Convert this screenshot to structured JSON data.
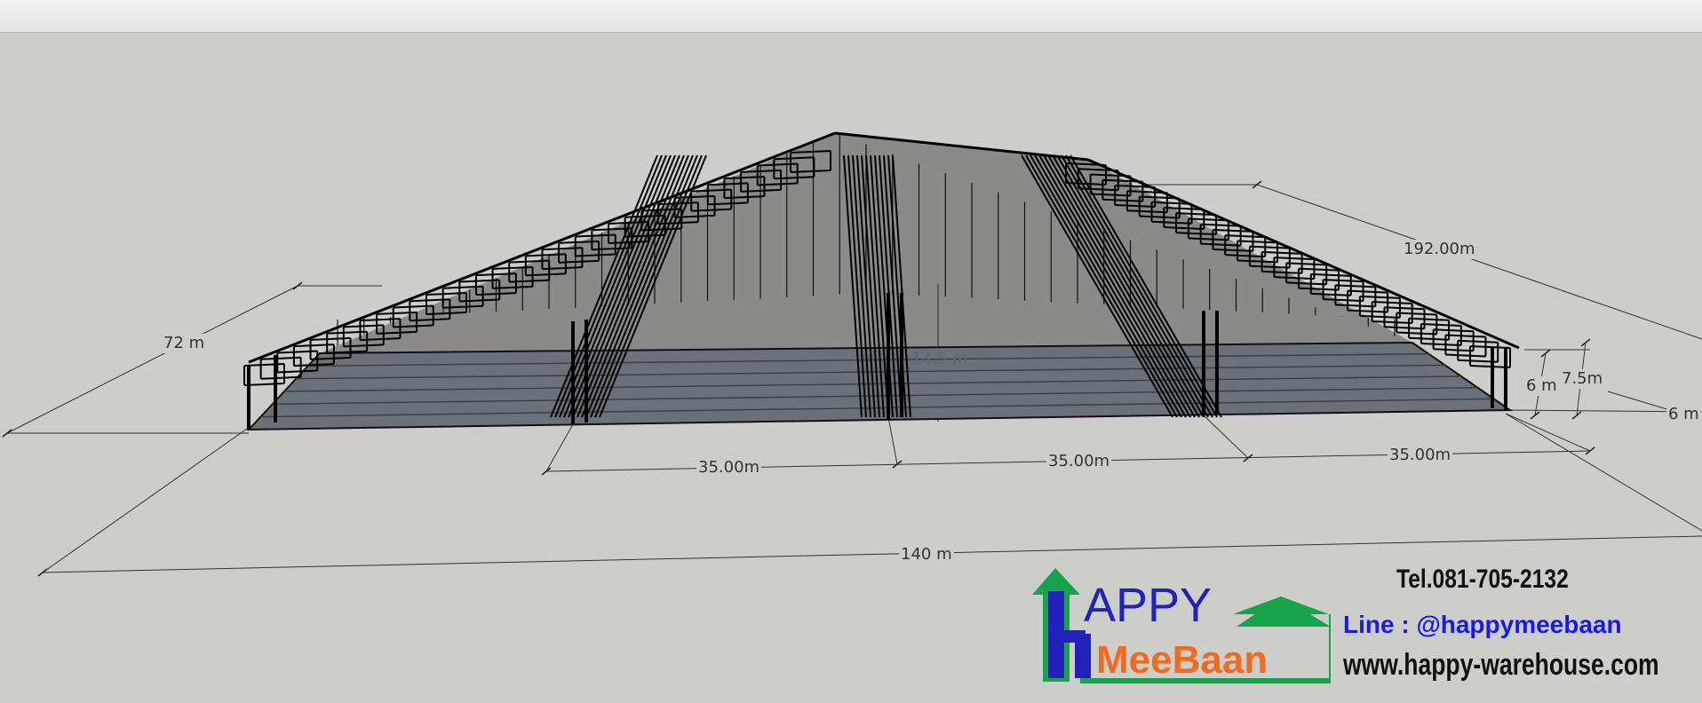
{
  "dimensions": {
    "left_depth": "72 m",
    "right_depth": "192.00m",
    "height": "14.5 m",
    "bay_1": "35.00m",
    "bay_2": "35.00m",
    "bay_3": "35.00m",
    "total_width": "140 m",
    "side_a": "6 m",
    "side_b": "7.5m",
    "side_c": "6 m"
  },
  "contact": {
    "tel": "Tel.081-705-2132",
    "line": "Line :  @happymeebaan",
    "website": "www.happy-warehouse.com"
  },
  "logo": {
    "word_top": "APPY",
    "word_bottom": "MeeBaan",
    "letter": "H",
    "colors": {
      "green": "#16a34a",
      "blue": "#2222bb",
      "orange": "#f26a21"
    }
  }
}
